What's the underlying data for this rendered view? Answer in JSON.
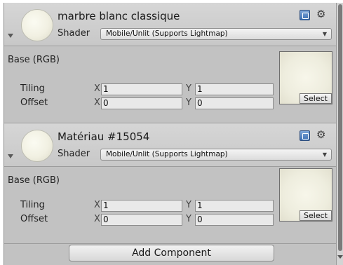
{
  "materials": [
    {
      "name": "marbre blanc classique",
      "shader_label": "Shader",
      "shader_value": "Mobile/Unlit (Supports Lightmap)",
      "base_label": "Base (RGB)",
      "tiling_label": "Tiling",
      "offset_label": "Offset",
      "axis_x": "X",
      "axis_y": "Y",
      "tiling_x": "1",
      "tiling_y": "1",
      "offset_x": "0",
      "offset_y": "0",
      "select_label": "Select"
    },
    {
      "name": "Matériau #15054",
      "shader_label": "Shader",
      "shader_value": "Mobile/Unlit (Supports Lightmap)",
      "base_label": "Base (RGB)",
      "tiling_label": "Tiling",
      "offset_label": "Offset",
      "axis_x": "X",
      "axis_y": "Y",
      "tiling_x": "1",
      "tiling_y": "1",
      "offset_x": "0",
      "offset_y": "0",
      "select_label": "Select"
    }
  ],
  "add_component_label": "Add Component",
  "icons": {
    "help": "help-book-icon",
    "settings": "gear-icon",
    "fold": "foldout-arrow-icon",
    "dropdown": "dropdown-arrow-icon"
  },
  "colors": {
    "panel": "#c2c2c2",
    "header": "#d0d0d0",
    "field": "#e9e9e9"
  }
}
